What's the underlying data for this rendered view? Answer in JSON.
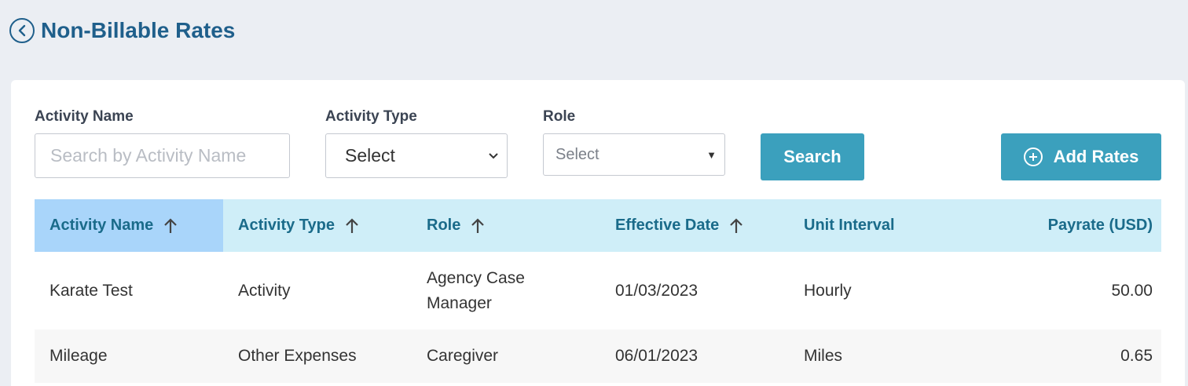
{
  "header": {
    "title": "Non-Billable Rates"
  },
  "filters": {
    "activity_name_label": "Activity Name",
    "activity_name_placeholder": "Search by Activity Name",
    "activity_type_label": "Activity Type",
    "activity_type_value": "Select",
    "role_label": "Role",
    "role_value": "Select",
    "search_label": "Search",
    "add_rates_label": "Add Rates"
  },
  "table": {
    "columns": [
      "Activity Name",
      "Activity Type",
      "Role",
      "Effective Date",
      "Unit Interval",
      "Payrate (USD)"
    ],
    "rows": [
      [
        "Karate Test",
        "Activity",
        "Agency Case Manager",
        "01/03/2023",
        "Hourly",
        "50.00"
      ],
      [
        "Mileage",
        "Other Expenses",
        "Caregiver",
        "06/01/2023",
        "Miles",
        "0.65"
      ]
    ]
  },
  "colors": {
    "accent": "#3ba0bd",
    "title": "#1f5f8b",
    "header_bg": "#cfeef8",
    "active_header_bg": "#a9d5fa"
  }
}
